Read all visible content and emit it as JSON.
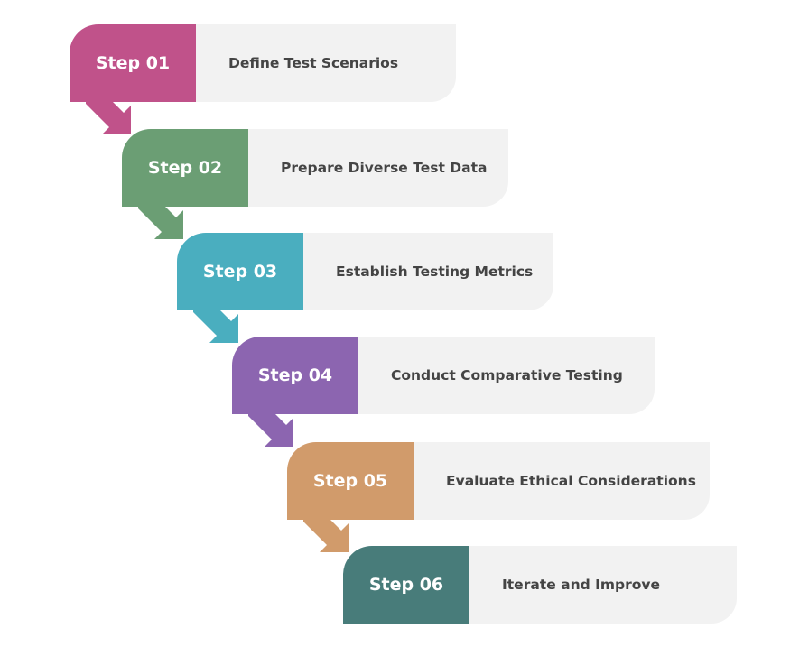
{
  "steps": [
    {
      "label": "Step 01",
      "text": "Define Test Scenarios",
      "color": "#c0528a"
    },
    {
      "label": "Step 02",
      "text": "Prepare Diverse Test Data",
      "color": "#6b9e74"
    },
    {
      "label": "Step 03",
      "text": "Establish Testing Metrics",
      "color": "#4aaebf"
    },
    {
      "label": "Step 04",
      "text": "Conduct Comparative Testing",
      "color": "#8c65b0"
    },
    {
      "label": "Step 05",
      "text": "Evaluate Ethical Considerations",
      "color": "#d19b6b"
    },
    {
      "label": "Step 06",
      "text": "Iterate and Improve",
      "color": "#487c7a"
    }
  ]
}
